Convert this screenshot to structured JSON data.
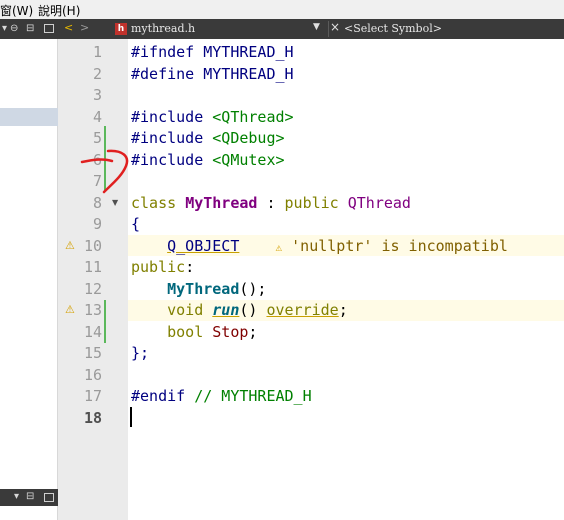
{
  "menubar": {
    "items": [
      {
        "label": "窗(W)"
      },
      {
        "label": "說明(H)"
      }
    ]
  },
  "editor_toolbar": {
    "file_name": "mythread.h",
    "symbol_selector": "<Select Symbol>",
    "file_icon_letter": "h"
  },
  "warning": {
    "text": "'nullptr' is incompatibl"
  },
  "lines": [
    {
      "num": "1"
    },
    {
      "num": "2"
    },
    {
      "num": "3"
    },
    {
      "num": "4"
    },
    {
      "num": "5"
    },
    {
      "num": "6"
    },
    {
      "num": "7"
    },
    {
      "num": "8"
    },
    {
      "num": "9"
    },
    {
      "num": "10"
    },
    {
      "num": "11"
    },
    {
      "num": "12"
    },
    {
      "num": "13"
    },
    {
      "num": "14"
    },
    {
      "num": "15"
    },
    {
      "num": "16"
    },
    {
      "num": "17"
    },
    {
      "num": "18"
    }
  ],
  "code": {
    "l1": {
      "pp": "#ifndef",
      "rest": " MYTHREAD_H"
    },
    "l2": {
      "pp": "#define",
      "rest": " MYTHREAD_H"
    },
    "l4": {
      "pp": "#include",
      "inc": "<QThread>"
    },
    "l5": {
      "pp": "#include",
      "inc": "<QDebug>"
    },
    "l6": {
      "pp": "#include",
      "inc": "<QMutex>"
    },
    "l8": {
      "kw": "class",
      "cls": "MyThread",
      "colon": " : ",
      "kw2": "public",
      "base": "QThread"
    },
    "l9": {
      "text": "{"
    },
    "l10": {
      "macro": "Q_OBJECT"
    },
    "l11": {
      "kw": "public",
      "colon": ":"
    },
    "l12": {
      "fn": "MyThread",
      "rest": "();"
    },
    "l13": {
      "kw": "void",
      "fn": "run",
      "paren": "()",
      "ovr": "override",
      "semi": ";"
    },
    "l14": {
      "kw": "bool",
      "field": "Stop",
      "semi": ";"
    },
    "l15": {
      "text": "};"
    },
    "l17": {
      "pp": "#endif",
      "cmt": "// MYTHREAD_H"
    }
  },
  "colors": {
    "keyword": "#808000",
    "preprocessor": "#000080",
    "include_path": "#008000",
    "class_name": "#800080",
    "function": "#00677c",
    "warning_icon": "#d4a000",
    "change_bar": "#5bb85b",
    "annotation_red": "#e02020"
  },
  "icons": {
    "warning": "warning-triangle-icon",
    "fold": "fold-arrow-icon",
    "back": "back-arrow-icon",
    "forward": "forward-arrow-icon",
    "close": "close-icon"
  }
}
